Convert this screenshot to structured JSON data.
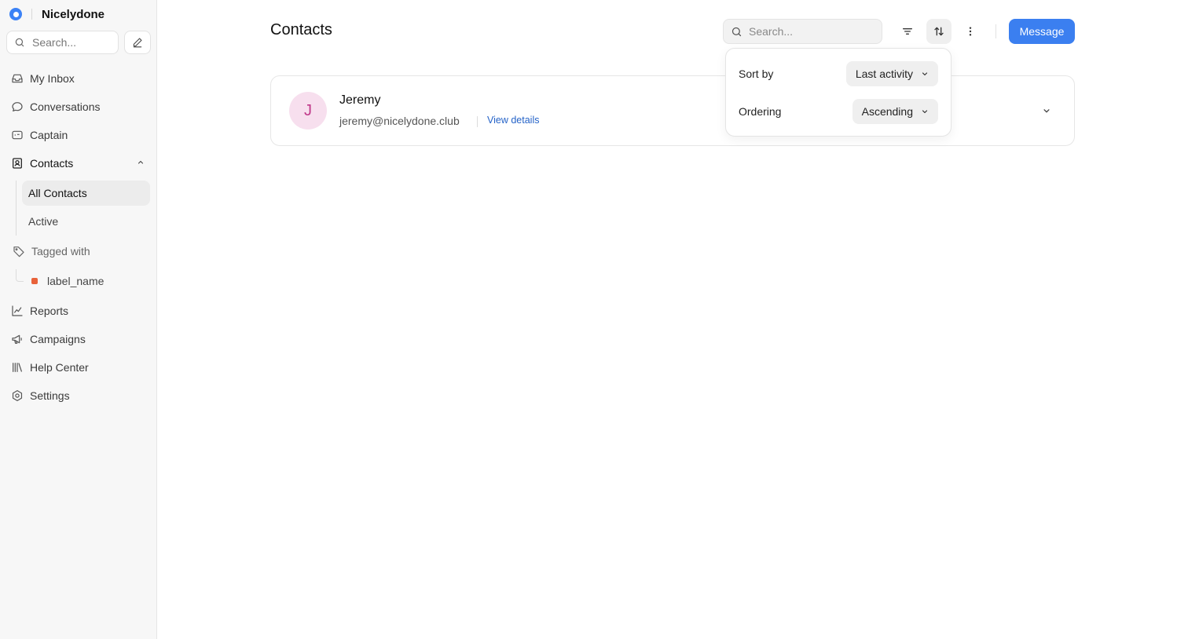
{
  "sidebar": {
    "brand": {
      "name": "Nicelydone",
      "logo_color": "#3b82f6"
    },
    "search": {
      "placeholder": "Search..."
    },
    "nav": {
      "my_inbox": "My Inbox",
      "conversations": "Conversations",
      "captain": "Captain",
      "contacts": "Contacts",
      "reports": "Reports",
      "campaigns": "Campaigns",
      "help_center": "Help Center",
      "settings": "Settings"
    },
    "contacts_sub": {
      "all_contacts": "All Contacts",
      "active": "Active",
      "active_item": "All Contacts"
    },
    "tagged_with": {
      "label": "Tagged with",
      "tags": [
        {
          "name": "label_name",
          "color": "#e8623a"
        }
      ]
    }
  },
  "header": {
    "title": "Contacts",
    "search_placeholder": "Search...",
    "message_button": "Message",
    "accent_color": "#3b7ff0"
  },
  "contacts": [
    {
      "initial": "J",
      "name": "Jeremy",
      "email": "jeremy@nicelydone.club",
      "view_details": "View details"
    }
  ],
  "sort_popover": {
    "open": true,
    "sort_by_label": "Sort by",
    "sort_by_value": "Last activity",
    "ordering_label": "Ordering",
    "ordering_value": "Ascending"
  }
}
